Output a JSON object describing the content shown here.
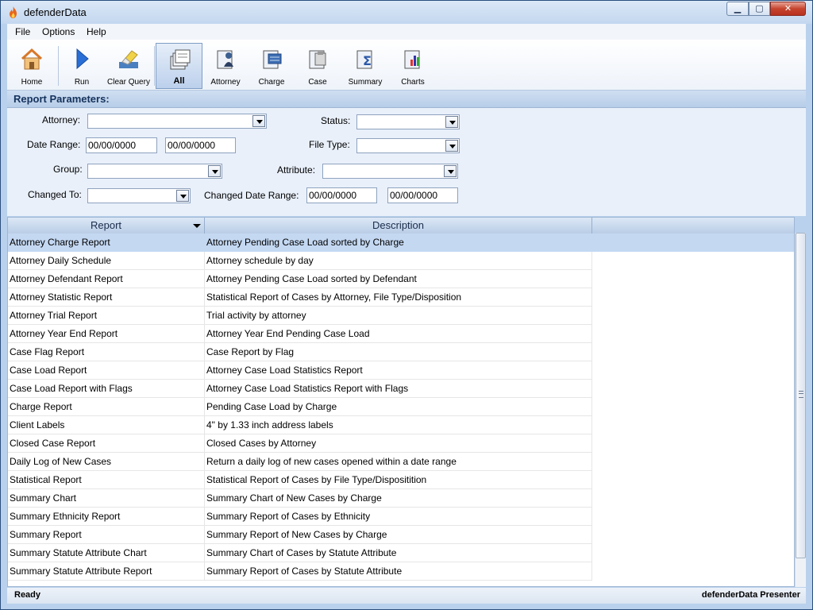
{
  "window": {
    "title": "defenderData"
  },
  "menu": {
    "file": "File",
    "options": "Options",
    "help": "Help"
  },
  "toolbar": {
    "home": "Home",
    "run": "Run",
    "clear_query": "Clear Query",
    "all": "All",
    "attorney": "Attorney",
    "charge": "Charge",
    "case": "Case",
    "summary": "Summary",
    "charts": "Charts"
  },
  "params": {
    "header": "Report Parameters:",
    "attorney_label": "Attorney:",
    "status_label": "Status:",
    "date_range_label": "Date Range:",
    "date_from": "00/00/0000",
    "date_to": "00/00/0000",
    "file_type_label": "File Type:",
    "group_label": "Group:",
    "attribute_label": "Attribute:",
    "changed_to_label": "Changed To:",
    "changed_date_range_label": "Changed Date Range:",
    "changed_from": "00/00/0000",
    "changed_to_date": "00/00/0000"
  },
  "grid": {
    "col_report": "Report",
    "col_description": "Description",
    "rows": [
      {
        "report": "Attorney Charge Report",
        "description": "Attorney Pending Case Load sorted by Charge"
      },
      {
        "report": "Attorney Daily Schedule",
        "description": "Attorney schedule by day"
      },
      {
        "report": "Attorney Defendant Report",
        "description": "Attorney Pending Case Load sorted by Defendant"
      },
      {
        "report": "Attorney Statistic Report",
        "description": "Statistical Report of Cases by Attorney, File Type/Disposition"
      },
      {
        "report": "Attorney Trial Report",
        "description": "Trial activity by attorney"
      },
      {
        "report": "Attorney Year End Report",
        "description": "Attorney Year End Pending Case Load"
      },
      {
        "report": "Case Flag Report",
        "description": "Case Report by Flag"
      },
      {
        "report": "Case Load Report",
        "description": "Attorney Case Load Statistics Report"
      },
      {
        "report": "Case Load Report with Flags",
        "description": "Attorney Case Load Statistics Report with Flags"
      },
      {
        "report": "Charge Report",
        "description": "Pending Case Load by Charge"
      },
      {
        "report": "Client Labels",
        "description": "4\" by 1.33 inch address labels"
      },
      {
        "report": "Closed Case Report",
        "description": "Closed Cases by Attorney"
      },
      {
        "report": "Daily Log of New Cases",
        "description": "Return a daily log of new cases opened within a date range"
      },
      {
        "report": "Statistical Report",
        "description": "Statistical Report of Cases by File Type/Dispositition"
      },
      {
        "report": "Summary Chart",
        "description": "Summary Chart of New Cases by Charge"
      },
      {
        "report": "Summary Ethnicity Report",
        "description": "Summary Report of Cases by Ethnicity"
      },
      {
        "report": "Summary Report",
        "description": "Summary Report of New Cases by Charge"
      },
      {
        "report": "Summary Statute Attribute Chart",
        "description": "Summary Chart of Cases by Statute Attribute"
      },
      {
        "report": "Summary Statute Attribute Report",
        "description": "Summary Report of Cases by Statute Attribute"
      }
    ]
  },
  "status": {
    "left": "Ready",
    "right": "defenderData Presenter"
  }
}
